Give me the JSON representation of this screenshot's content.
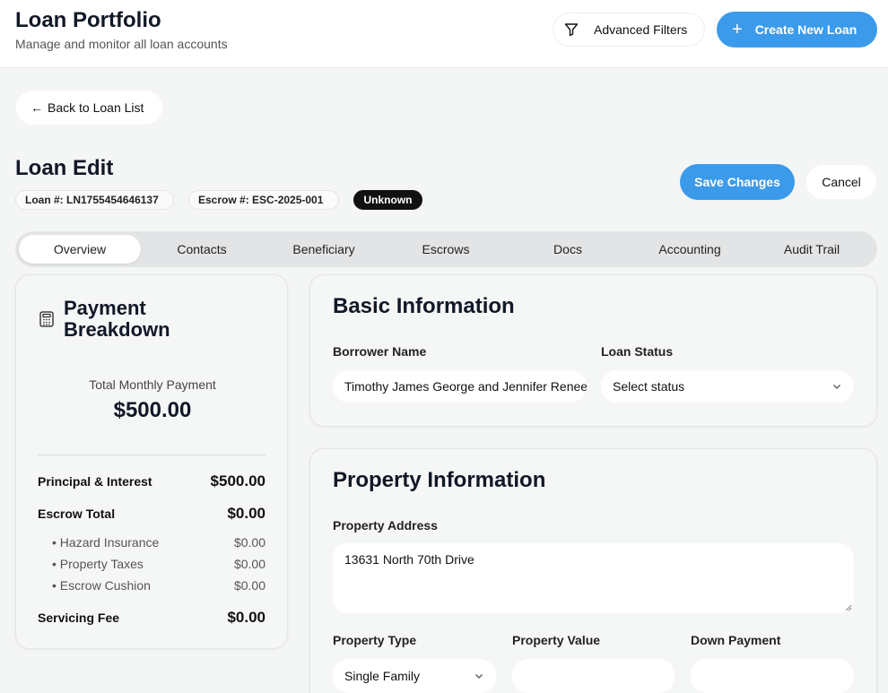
{
  "header": {
    "title": "Loan Portfolio",
    "subtitle": "Manage and monitor all loan accounts",
    "filters_label": "Advanced Filters",
    "create_label": "Create New Loan"
  },
  "nav": {
    "back_label": "Back to Loan List"
  },
  "loan": {
    "title": "Loan Edit",
    "loan_number": "Loan #: LN1755454646137",
    "escrow_number": "Escrow #: ESC-2025-001",
    "status_badge": "Unknown",
    "save_label": "Save Changes",
    "cancel_label": "Cancel"
  },
  "tabs": [
    "Overview",
    "Contacts",
    "Beneficiary",
    "Escrows",
    "Docs",
    "Accounting",
    "Audit Trail"
  ],
  "active_tab": "Overview",
  "payment": {
    "title": "Payment Breakdown",
    "total_label": "Total Monthly Payment",
    "total_value": "$500.00",
    "rows": [
      {
        "label": "Principal & Interest",
        "value": "$500.00"
      },
      {
        "label": "Escrow Total",
        "value": "$0.00"
      }
    ],
    "escrow_items": [
      {
        "label": "• Hazard Insurance",
        "value": "$0.00"
      },
      {
        "label": "• Property Taxes",
        "value": "$0.00"
      },
      {
        "label": "• Escrow Cushion",
        "value": "$0.00"
      }
    ],
    "servicing": {
      "label": "Servicing Fee",
      "value": "$0.00"
    }
  },
  "basic": {
    "title": "Basic Information",
    "borrower_label": "Borrower Name",
    "borrower_value": "Timothy James George and Jennifer Renee George",
    "status_label": "Loan Status",
    "status_value": "Select status"
  },
  "property": {
    "title": "Property Information",
    "address_label": "Property Address",
    "address_value": "13631 North 70th Drive",
    "type_label": "Property Type",
    "type_value": "Single Family",
    "value_label": "Property Value",
    "value_value": "",
    "down_label": "Down Payment",
    "down_value": ""
  },
  "colors": {
    "accent": "#3b9bea",
    "badge_bg": "#111111"
  }
}
